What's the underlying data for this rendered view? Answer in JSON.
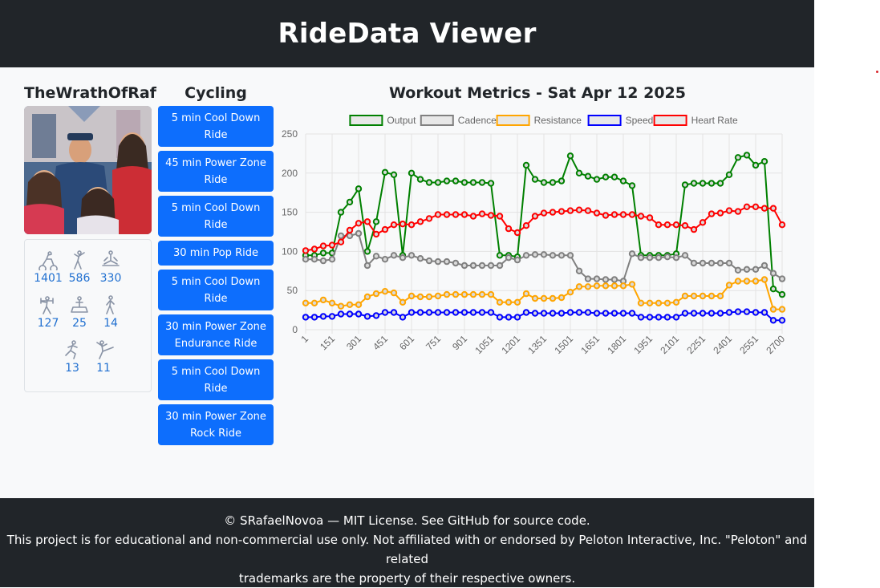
{
  "app": {
    "title": "RideData Viewer"
  },
  "user": {
    "name": "TheWrathOfRaf",
    "stats": [
      {
        "icon": "cycling-icon",
        "value": "1401"
      },
      {
        "icon": "stretching-icon",
        "value": "586"
      },
      {
        "icon": "meditation-icon",
        "value": "330"
      },
      {
        "icon": "strength-icon",
        "value": "127"
      },
      {
        "icon": "bootcamp-icon",
        "value": "25"
      },
      {
        "icon": "walking-icon",
        "value": "14"
      },
      {
        "icon": "running-icon",
        "value": "13"
      },
      {
        "icon": "yoga-icon",
        "value": "11"
      }
    ]
  },
  "classes": {
    "heading": "Cycling",
    "rides": [
      {
        "line1": "5 min Cool Down",
        "line2": "Ride"
      },
      {
        "line1": "45 min Power Zone",
        "line2": "Ride"
      },
      {
        "line1": "5 min Cool Down",
        "line2": "Ride"
      },
      {
        "line1": "30 min Pop Ride",
        "line2": ""
      },
      {
        "line1": "5 min Cool Down",
        "line2": "Ride"
      },
      {
        "line1": "30 min Power Zone",
        "line2": "Endurance Ride"
      },
      {
        "line1": "5 min Cool Down",
        "line2": "Ride"
      },
      {
        "line1": "30 min Power Zone",
        "line2": "Rock Ride"
      }
    ]
  },
  "chart": {
    "title": "Workout Metrics - Sat Apr 12 2025"
  },
  "chart_data": {
    "type": "line",
    "title": "Workout Metrics - Sat Apr 12 2025",
    "x_ticks": [
      "1",
      "151",
      "301",
      "451",
      "601",
      "751",
      "901",
      "1051",
      "1201",
      "1351",
      "1501",
      "1651",
      "1801",
      "1951",
      "2101",
      "2251",
      "2401",
      "2551",
      "2700"
    ],
    "ylim": [
      0,
      250
    ],
    "y_ticks": [
      0,
      50,
      100,
      150,
      200,
      250
    ],
    "grid": true,
    "legend": "top",
    "series": [
      {
        "name": "Output",
        "color": "#008000",
        "values": [
          95,
          95,
          98,
          98,
          150,
          163,
          180,
          100,
          138,
          201,
          198,
          95,
          200,
          192,
          188,
          188,
          190,
          190,
          188,
          188,
          188,
          187,
          95,
          95,
          93,
          210,
          192,
          188,
          188,
          190,
          222,
          200,
          196,
          192,
          195,
          195,
          190,
          184,
          95,
          95,
          95,
          95,
          97,
          185,
          187,
          187,
          187,
          187,
          198,
          220,
          223,
          210,
          215,
          52,
          45
        ]
      },
      {
        "name": "Cadence",
        "color": "#808080",
        "values": [
          90,
          90,
          88,
          90,
          120,
          120,
          123,
          82,
          94,
          90,
          95,
          92,
          95,
          91,
          88,
          87,
          87,
          85,
          82,
          82,
          82,
          82,
          82,
          92,
          89,
          95,
          96,
          96,
          95,
          95,
          95,
          75,
          65,
          65,
          64,
          64,
          62,
          97,
          92,
          92,
          92,
          93,
          92,
          95,
          85,
          85,
          85,
          85,
          85,
          76,
          77,
          77,
          82,
          72,
          65
        ]
      },
      {
        "name": "Resistance",
        "color": "#FFA500",
        "values": [
          34,
          34,
          38,
          34,
          30,
          32,
          32,
          42,
          46,
          49,
          47,
          35,
          43,
          42,
          42,
          43,
          45,
          45,
          45,
          45,
          45,
          45,
          35,
          35,
          35,
          46,
          40,
          40,
          40,
          41,
          48,
          55,
          55,
          56,
          56,
          56,
          56,
          58,
          34,
          34,
          34,
          34,
          35,
          43,
          43,
          43,
          43,
          43,
          57,
          62,
          62,
          62,
          64,
          26,
          26
        ]
      },
      {
        "name": "Speed",
        "color": "#0000FF",
        "values": [
          16,
          16,
          17,
          17,
          20,
          20,
          20,
          17,
          18,
          22,
          22,
          16,
          22,
          22,
          22,
          22,
          22,
          22,
          22,
          22,
          22,
          22,
          16,
          16,
          16,
          22,
          21,
          21,
          21,
          21,
          22,
          22,
          22,
          21,
          21,
          21,
          21,
          21,
          16,
          16,
          16,
          16,
          16,
          21,
          21,
          21,
          21,
          21,
          22,
          23,
          23,
          22,
          22,
          12,
          12
        ]
      },
      {
        "name": "Heart Rate",
        "color": "#FF0000",
        "values": [
          101,
          103,
          107,
          108,
          112,
          127,
          136,
          138,
          122,
          128,
          134,
          135,
          134,
          138,
          142,
          147,
          147,
          147,
          147,
          145,
          148,
          146,
          145,
          129,
          124,
          133,
          145,
          149,
          150,
          151,
          152,
          153,
          152,
          149,
          146,
          147,
          147,
          147,
          145,
          143,
          134,
          134,
          134,
          133,
          128,
          137,
          148,
          149,
          152,
          151,
          157,
          157,
          155,
          155,
          134
        ]
      }
    ]
  },
  "footer": {
    "line1": "© SRafaelNovoa — MIT License. See GitHub for source code.",
    "line2": "This project is for educational and non-commercial use only. Not affiliated with or endorsed by Peloton Interactive, Inc. \"Peloton\" and related",
    "line3": "trademarks are the property of their respective owners."
  }
}
